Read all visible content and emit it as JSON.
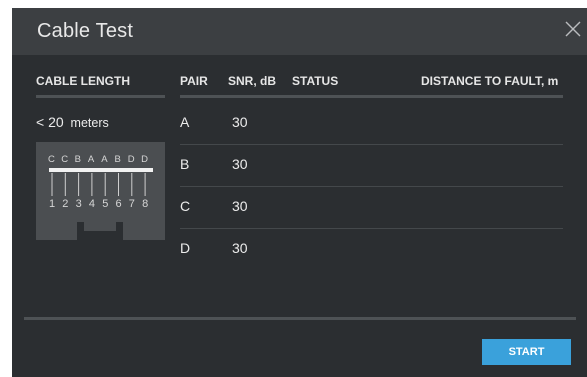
{
  "dialog": {
    "title": "Cable Test"
  },
  "columns": {
    "cable_length": "CABLE LENGTH",
    "pair": "PAIR",
    "snr": "SNR, dB",
    "status": "STATUS",
    "distance": "DISTANCE TO FAULT, m"
  },
  "cable_length_value": "< 20",
  "cable_length_unit": "meters",
  "connector": {
    "pair_letters": [
      "C",
      "C",
      "B",
      "A",
      "A",
      "B",
      "D",
      "D"
    ],
    "pin_numbers": [
      "1",
      "2",
      "3",
      "4",
      "5",
      "6",
      "7",
      "8"
    ]
  },
  "rows": [
    {
      "pair": "A",
      "snr": "30",
      "status": "",
      "distance": ""
    },
    {
      "pair": "B",
      "snr": "30",
      "status": "",
      "distance": ""
    },
    {
      "pair": "C",
      "snr": "30",
      "status": "",
      "distance": ""
    },
    {
      "pair": "D",
      "snr": "30",
      "status": "",
      "distance": ""
    }
  ],
  "buttons": {
    "start": "START"
  },
  "colors": {
    "accent": "#3aa1db",
    "dialog_bg": "#2b2e31",
    "titlebar_bg": "#3c3f42"
  }
}
